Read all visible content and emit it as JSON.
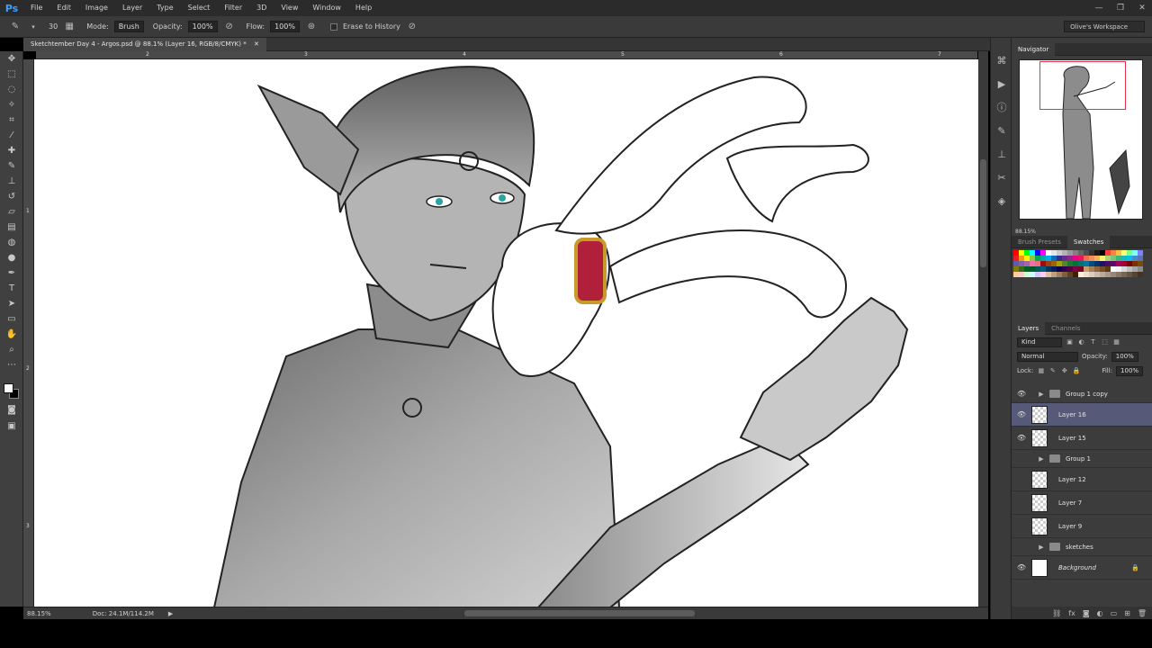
{
  "app": {
    "logo": "Ps",
    "menu": [
      "File",
      "Edit",
      "Image",
      "Layer",
      "Type",
      "Select",
      "Filter",
      "3D",
      "View",
      "Window",
      "Help"
    ],
    "window_controls": [
      "—",
      "❐",
      "✕"
    ]
  },
  "options": {
    "brush_size": "30",
    "mode_label": "Mode:",
    "mode_value": "Brush",
    "opacity_label": "Opacity:",
    "opacity_value": "100%",
    "flow_label": "Flow:",
    "flow_value": "100%",
    "erase_history_label": "Erase to History",
    "workspace": "Olive's Workspace"
  },
  "document": {
    "tab_title": "Sketchtember Day 4 - Argos.psd @ 88.1% (Layer 16, RGB/8/CMYK) *",
    "ruler_top_numbers": [
      "2",
      "3",
      "4",
      "5",
      "6",
      "7"
    ],
    "ruler_left_numbers": [
      "1",
      "2",
      "3"
    ]
  },
  "status": {
    "zoom": "88.15%",
    "doc": "Doc: 24.1M/114.2M"
  },
  "navigator": {
    "tab": "Navigator",
    "zoom": "88.15%"
  },
  "swatches": {
    "tabs": [
      "Brush Presets",
      "Swatches"
    ],
    "colors": [
      "#ff0000",
      "#ffff00",
      "#00ff00",
      "#00ffff",
      "#0000ff",
      "#ff00ff",
      "#ffffff",
      "#e6e6e6",
      "#cccccc",
      "#b3b3b3",
      "#999999",
      "#808080",
      "#666666",
      "#4d4d4d",
      "#333333",
      "#1a1a1a",
      "#000000",
      "#ff4040",
      "#ff8040",
      "#ffc040",
      "#ffff80",
      "#80ff80",
      "#80ffff",
      "#8080ff",
      "#ed1c24",
      "#f7941d",
      "#fff200",
      "#8dc63f",
      "#00a651",
      "#00a99d",
      "#00aeef",
      "#0072bc",
      "#2e3192",
      "#662d91",
      "#92278f",
      "#ec008c",
      "#ed145b",
      "#f26c4f",
      "#f68e56",
      "#fbaf5d",
      "#fff568",
      "#acd373",
      "#7cc576",
      "#3bb878",
      "#1abbb4",
      "#00bff3",
      "#448ccb",
      "#5674b9",
      "#605ca8",
      "#8560a8",
      "#a864a8",
      "#f06eaa",
      "#f26d7d",
      "#9e0b0f",
      "#a0410d",
      "#a36209",
      "#aba000",
      "#598527",
      "#1a7b30",
      "#007236",
      "#00746b",
      "#0076a3",
      "#004b80",
      "#003471",
      "#1b1464",
      "#440e62",
      "#630460",
      "#9e005d",
      "#9e0039",
      "#790000",
      "#7b2e00",
      "#7d4900",
      "#827b00",
      "#406618",
      "#005e20",
      "#005826",
      "#005952",
      "#005b7f",
      "#003663",
      "#002157",
      "#0d004c",
      "#32004b",
      "#4b0049",
      "#7b0046",
      "#7a0026",
      "#c69c6d",
      "#a67c52",
      "#8c6239",
      "#754c24",
      "#603913",
      "#ffffff",
      "#f2f2f2",
      "#d9d9d9",
      "#bfbfbf",
      "#a6a6a6",
      "#8c8c8c",
      "#ffcc99",
      "#ffcccc",
      "#ccffcc",
      "#ccffff",
      "#ccccff",
      "#ffccff",
      "#e0c0a0",
      "#c0a080",
      "#a08060",
      "#806040",
      "#604020",
      "#402000",
      "#ffeedd",
      "#eeddcc",
      "#ddccbb",
      "#ccbbaa",
      "#bbaa99",
      "#aa9988",
      "#998877",
      "#887766",
      "#776655",
      "#665544",
      "#554433",
      "#443322"
    ]
  },
  "layers": {
    "tabs": [
      "Layers",
      "Channels"
    ],
    "kind": "Kind",
    "blend_mode": "Normal",
    "opacity_label": "Opacity:",
    "opacity_value": "100%",
    "lock_label": "Lock:",
    "fill_label": "Fill:",
    "fill_value": "100%",
    "items": [
      {
        "name": "Group 1 copy",
        "type": "group",
        "visible": true
      },
      {
        "name": "Layer 16",
        "type": "layer",
        "visible": true,
        "selected": true
      },
      {
        "name": "Layer 15",
        "type": "layer",
        "visible": true
      },
      {
        "name": "Group 1",
        "type": "group",
        "visible": false
      },
      {
        "name": "Layer 12",
        "type": "layer",
        "visible": false
      },
      {
        "name": "Layer 7",
        "type": "layer",
        "visible": false
      },
      {
        "name": "Layer 9",
        "type": "layer",
        "visible": false
      },
      {
        "name": "sketches",
        "type": "group",
        "visible": false
      },
      {
        "name": "Background",
        "type": "background",
        "visible": true,
        "locked": true
      }
    ]
  },
  "colors": {
    "accent_selected": "#565a78",
    "bracelet_red": "#b0203a",
    "bracelet_gold": "#c89a2a",
    "eye_teal": "#2aa6a0"
  }
}
